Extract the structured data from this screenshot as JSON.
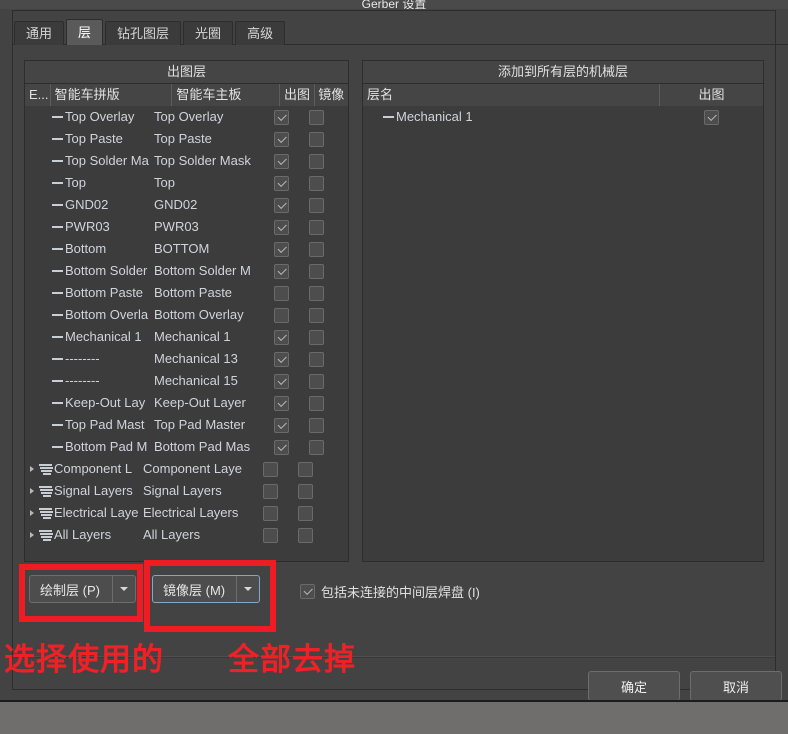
{
  "window": {
    "title": "Gerber 设置"
  },
  "tabs": [
    {
      "label": "通用",
      "active": false
    },
    {
      "label": "层",
      "active": true
    },
    {
      "label": "钻孔图层",
      "active": false
    },
    {
      "label": "光圈",
      "active": false
    },
    {
      "label": "高级",
      "active": false
    }
  ],
  "left_panel": {
    "title": "出图层",
    "headers": [
      "E...",
      "智能车拼版",
      "智能车主板",
      "出图",
      "镜像"
    ],
    "rows": [
      {
        "icon": "dash-icon",
        "expandable": false,
        "name_a": "Top Overlay",
        "name_b": "Top Overlay",
        "plot": true,
        "mirror": false
      },
      {
        "icon": "dash-icon",
        "expandable": false,
        "name_a": "Top Paste",
        "name_b": "Top Paste",
        "plot": true,
        "mirror": false
      },
      {
        "icon": "dash-icon",
        "expandable": false,
        "name_a": "Top Solder Ma",
        "name_b": "Top Solder Mask",
        "plot": true,
        "mirror": false
      },
      {
        "icon": "dash-icon",
        "expandable": false,
        "name_a": "Top",
        "name_b": "Top",
        "plot": true,
        "mirror": false
      },
      {
        "icon": "dash-icon",
        "expandable": false,
        "name_a": "GND02",
        "name_b": "GND02",
        "plot": true,
        "mirror": false
      },
      {
        "icon": "dash-icon",
        "expandable": false,
        "name_a": "PWR03",
        "name_b": "PWR03",
        "plot": true,
        "mirror": false
      },
      {
        "icon": "dash-icon",
        "expandable": false,
        "name_a": "Bottom",
        "name_b": "BOTTOM",
        "plot": true,
        "mirror": false
      },
      {
        "icon": "dash-icon",
        "expandable": false,
        "name_a": "Bottom Solder",
        "name_b": "Bottom Solder M",
        "plot": true,
        "mirror": false
      },
      {
        "icon": "dash-icon",
        "expandable": false,
        "name_a": "Bottom Paste",
        "name_b": "Bottom Paste",
        "plot": false,
        "mirror": false
      },
      {
        "icon": "dash-icon",
        "expandable": false,
        "name_a": "Bottom Overla",
        "name_b": "Bottom Overlay",
        "plot": false,
        "mirror": false
      },
      {
        "icon": "dash-icon",
        "expandable": false,
        "name_a": "Mechanical 1",
        "name_b": "Mechanical 1",
        "plot": true,
        "mirror": false
      },
      {
        "icon": "dash-icon",
        "expandable": false,
        "name_a": "--------",
        "name_b": "Mechanical 13",
        "plot": true,
        "mirror": false
      },
      {
        "icon": "dash-icon",
        "expandable": false,
        "name_a": "--------",
        "name_b": "Mechanical 15",
        "plot": true,
        "mirror": false
      },
      {
        "icon": "dash-icon",
        "expandable": false,
        "name_a": "Keep-Out Lay",
        "name_b": "Keep-Out Layer",
        "plot": true,
        "mirror": false
      },
      {
        "icon": "dash-icon",
        "expandable": false,
        "name_a": "Top Pad Mast",
        "name_b": "Top Pad Master",
        "plot": true,
        "mirror": false
      },
      {
        "icon": "dash-icon",
        "expandable": false,
        "name_a": "Bottom Pad M",
        "name_b": "Bottom Pad Mas",
        "plot": true,
        "mirror": false
      },
      {
        "icon": "layer-group-icon",
        "expandable": true,
        "name_a": "Component L",
        "name_b": "Component Laye",
        "plot": false,
        "mirror": false
      },
      {
        "icon": "layer-group-icon",
        "expandable": true,
        "name_a": "Signal Layers",
        "name_b": "Signal Layers",
        "plot": false,
        "mirror": false
      },
      {
        "icon": "layer-group-icon",
        "expandable": true,
        "name_a": "Electrical Laye",
        "name_b": "Electrical Layers",
        "plot": false,
        "mirror": false
      },
      {
        "icon": "layer-group-icon",
        "expandable": true,
        "name_a": "All Layers",
        "name_b": "All Layers",
        "plot": false,
        "mirror": false
      }
    ]
  },
  "right_panel": {
    "title": "添加到所有层的机械层",
    "headers": [
      "层名",
      "出图"
    ],
    "rows": [
      {
        "icon": "dash-icon",
        "name": "Mechanical 1",
        "plot": true
      }
    ]
  },
  "controls": {
    "plot_layers_button": "绘制层 (P)",
    "mirror_layers_button": "镜像层 (M)",
    "include_pads_checkbox": {
      "label": "包括未连接的中间层焊盘 (I)",
      "checked": true
    }
  },
  "footer": {
    "ok": "确定",
    "cancel": "取消"
  },
  "annotations": [
    {
      "text": "选择使用的",
      "color": "#ef2127"
    },
    {
      "text": "全部去掉",
      "color": "#ef2127"
    }
  ],
  "colors": {
    "dialog_bg": "#434343",
    "panel_bg": "#3c3c3c",
    "header_bg": "#454545",
    "accent_red": "#ef1c23",
    "focus_blue": "#7fa8c9",
    "text": "#e0e0e0"
  }
}
